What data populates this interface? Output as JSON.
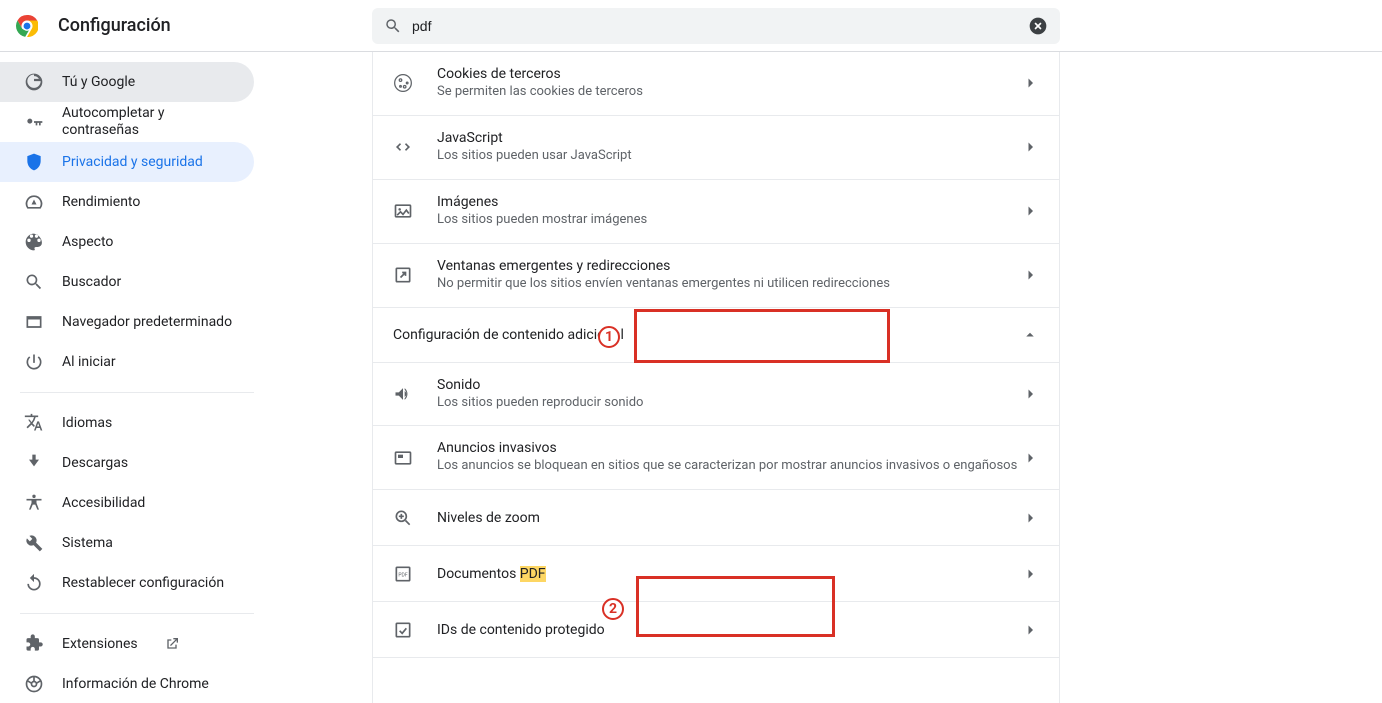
{
  "header": {
    "title": "Configuración"
  },
  "search": {
    "value": "pdf"
  },
  "sidebar": {
    "items": [
      {
        "label": "Tú y Google"
      },
      {
        "label": "Autocompletar y contraseñas"
      },
      {
        "label": "Privacidad y seguridad"
      },
      {
        "label": "Rendimiento"
      },
      {
        "label": "Aspecto"
      },
      {
        "label": "Buscador"
      },
      {
        "label": "Navegador predeterminado"
      },
      {
        "label": "Al iniciar"
      },
      {
        "label": "Idiomas"
      },
      {
        "label": "Descargas"
      },
      {
        "label": "Accesibilidad"
      },
      {
        "label": "Sistema"
      },
      {
        "label": "Restablecer configuración"
      },
      {
        "label": "Extensiones"
      },
      {
        "label": "Información de Chrome"
      }
    ]
  },
  "content": {
    "rows": [
      {
        "title": "Cookies de terceros",
        "sub": "Se permiten las cookies de terceros"
      },
      {
        "title": "JavaScript",
        "sub": "Los sitios pueden usar JavaScript"
      },
      {
        "title": "Imágenes",
        "sub": "Los sitios pueden mostrar imágenes"
      },
      {
        "title": "Ventanas emergentes y redirecciones",
        "sub": "No permitir que los sitios envíen ventanas emergentes ni utilicen redirecciones"
      }
    ],
    "section_header": "Configuración de contenido adicional",
    "rows2": [
      {
        "title": "Sonido",
        "sub": "Los sitios pueden reproducir sonido"
      },
      {
        "title": "Anuncios invasivos",
        "sub": "Los anuncios se bloquean en sitios que se caracterizan por mostrar anuncios invasivos o engañosos"
      },
      {
        "title": "Niveles de zoom",
        "sub": ""
      },
      {
        "title_prefix": "Documentos ",
        "title_highlight": "PDF",
        "sub": ""
      },
      {
        "title": "IDs de contenido protegido",
        "sub": ""
      }
    ]
  },
  "annotations": {
    "a1": "1",
    "a2": "2"
  }
}
